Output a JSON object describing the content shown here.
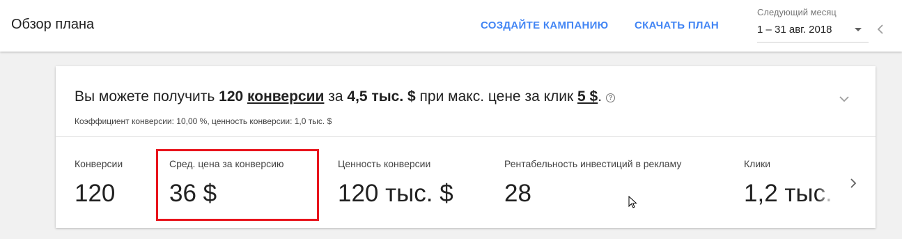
{
  "header": {
    "title": "Обзор плана",
    "create_campaign": "СОЗДАЙТЕ КАМПАНИЮ",
    "download_plan": "СКАЧАТЬ ПЛАН",
    "date_range_label": "Следующий месяц",
    "date_range_value": "1 – 31 авг. 2018"
  },
  "summary": {
    "prefix": "Вы можете получить ",
    "conversions_count": "120",
    "conversions_word": "конверсии",
    "for_text": " за ",
    "cost": "4,5 тыс. $",
    "bid_text": " при макс. цене за клик ",
    "max_cpc": "5 $",
    "end": ".",
    "help_glyph": "?",
    "details": "Коэффициент конверсии: 10,00 %, ценность конверсии: 1,0 тыс. $"
  },
  "metrics": [
    {
      "label": "Конверсии",
      "value": "120"
    },
    {
      "label": "Сред. цена за конверсию",
      "value": "36 $"
    },
    {
      "label": "Ценность конверсии",
      "value": "120 тыс. $"
    },
    {
      "label": "Рентабельность инвестиций в рекламу",
      "value": "28"
    },
    {
      "label": "Клики",
      "value": "1,2 тыс."
    }
  ],
  "colors": {
    "accent": "#4285f4",
    "highlight": "#e8141c"
  },
  "icons": {
    "date_dropdown": "chevron-down-icon",
    "prev": "chevron-left-icon",
    "expand": "chevron-down-icon",
    "next": "chevron-right-icon",
    "help": "help-icon",
    "cursor": "mouse-cursor-icon"
  }
}
